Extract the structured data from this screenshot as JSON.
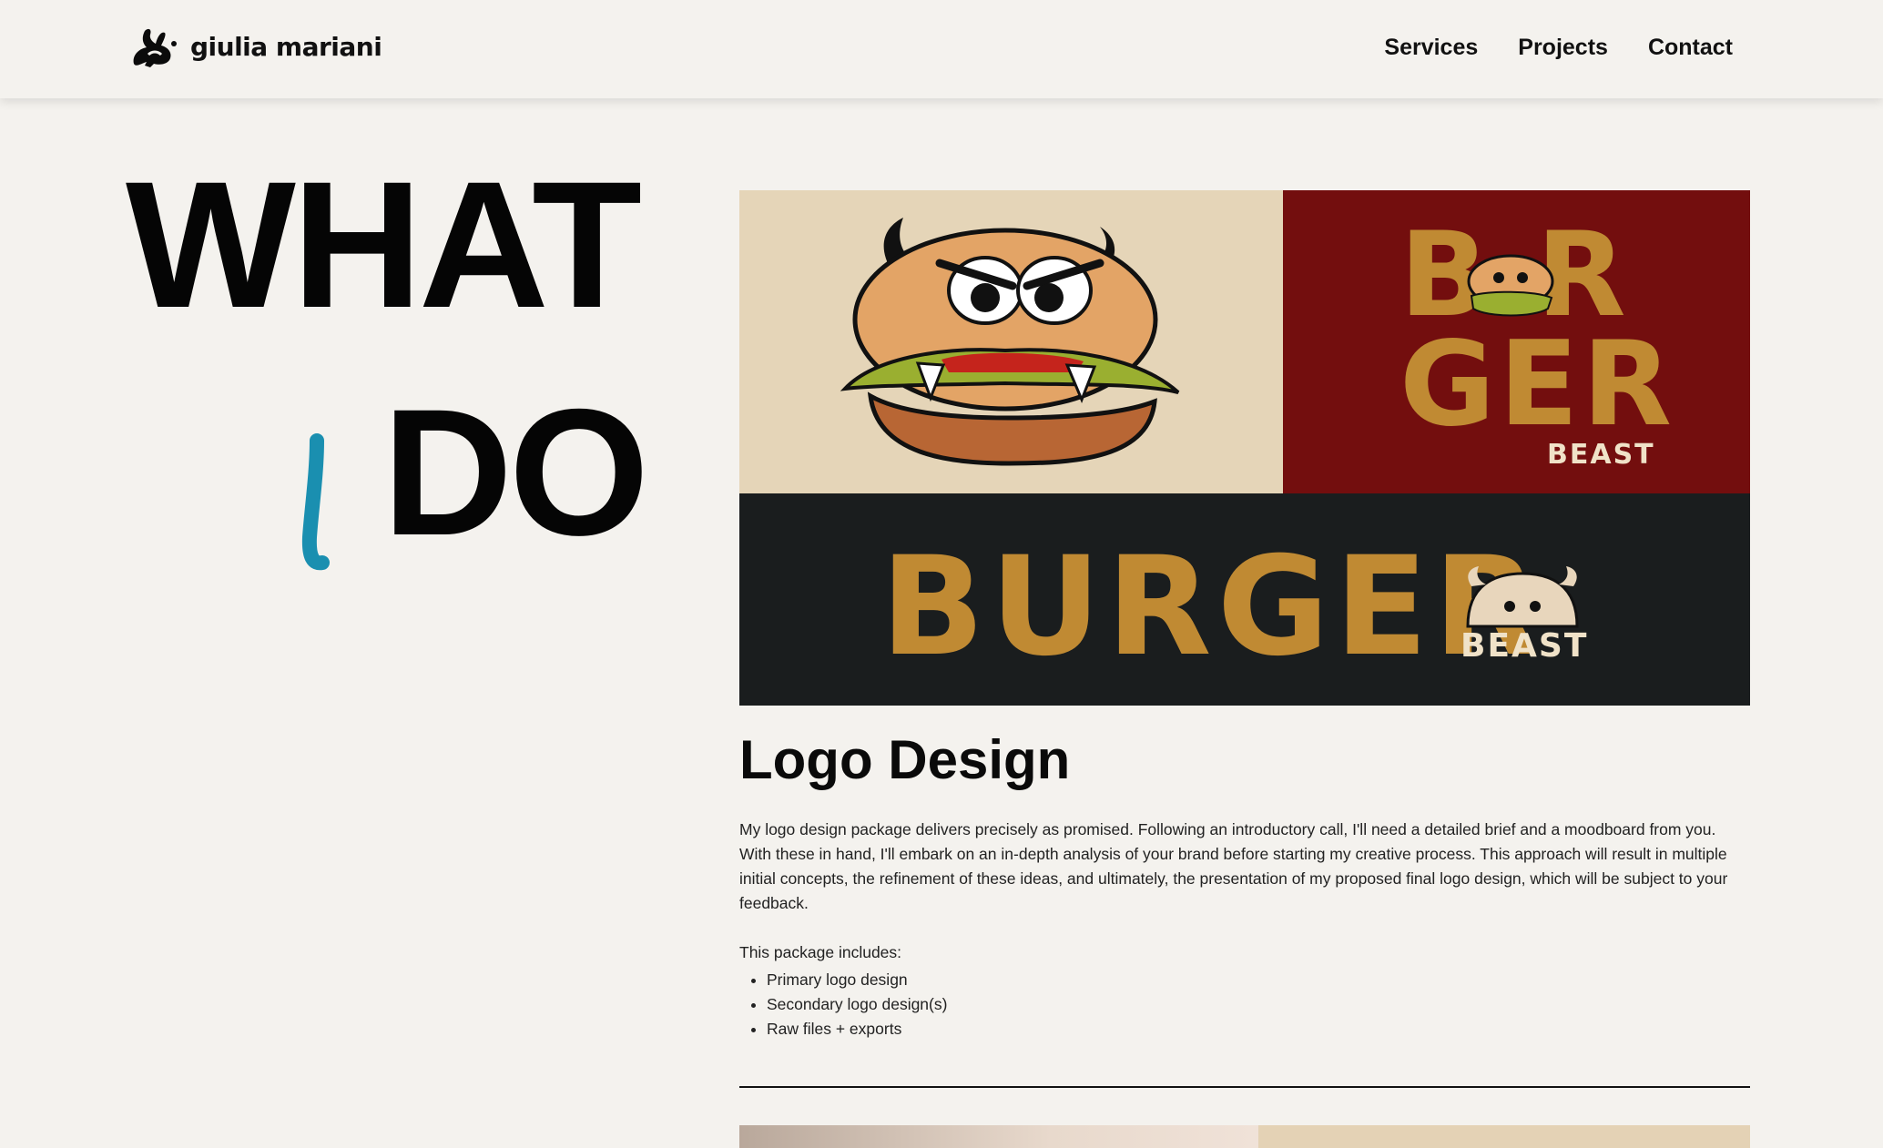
{
  "brand": {
    "name": "giulia mariani",
    "logo_icon": "rabbit-logo-icon"
  },
  "nav": {
    "items": [
      {
        "label": "Services"
      },
      {
        "label": "Projects"
      },
      {
        "label": "Contact"
      }
    ]
  },
  "hero": {
    "line1": "WHAT",
    "line2": "DO",
    "line2_prefix_icon": "handwritten-i-icon"
  },
  "service": {
    "image_texts": {
      "red_top": "B R",
      "red_bottom": "GER",
      "red_beast": "BEAST",
      "dark_burger": "BURGER",
      "dark_beast": "BEAST"
    },
    "title": "Logo Design",
    "description": "My logo design package delivers precisely as promised. Following an introductory call, I'll need a detailed brief and a moodboard from you. With these in hand, I'll embark on an in-depth analysis of your brand before starting my creative process. This approach will result in multiple initial concepts, the refinement of these ideas, and ultimately, the presentation of my proposed final logo design, which will be subject to your feedback.",
    "includes_label": "This package includes:",
    "includes": [
      "Primary logo design",
      "Secondary logo design(s)",
      "Raw files + exports"
    ]
  },
  "colors": {
    "background": "#f4f2ee",
    "accent_blue": "#1a8fb0",
    "burger_gold": "#c08a33",
    "panel_red": "#730e0e",
    "panel_cream": "#e5d5b8",
    "panel_dark": "#1a1d1e"
  }
}
